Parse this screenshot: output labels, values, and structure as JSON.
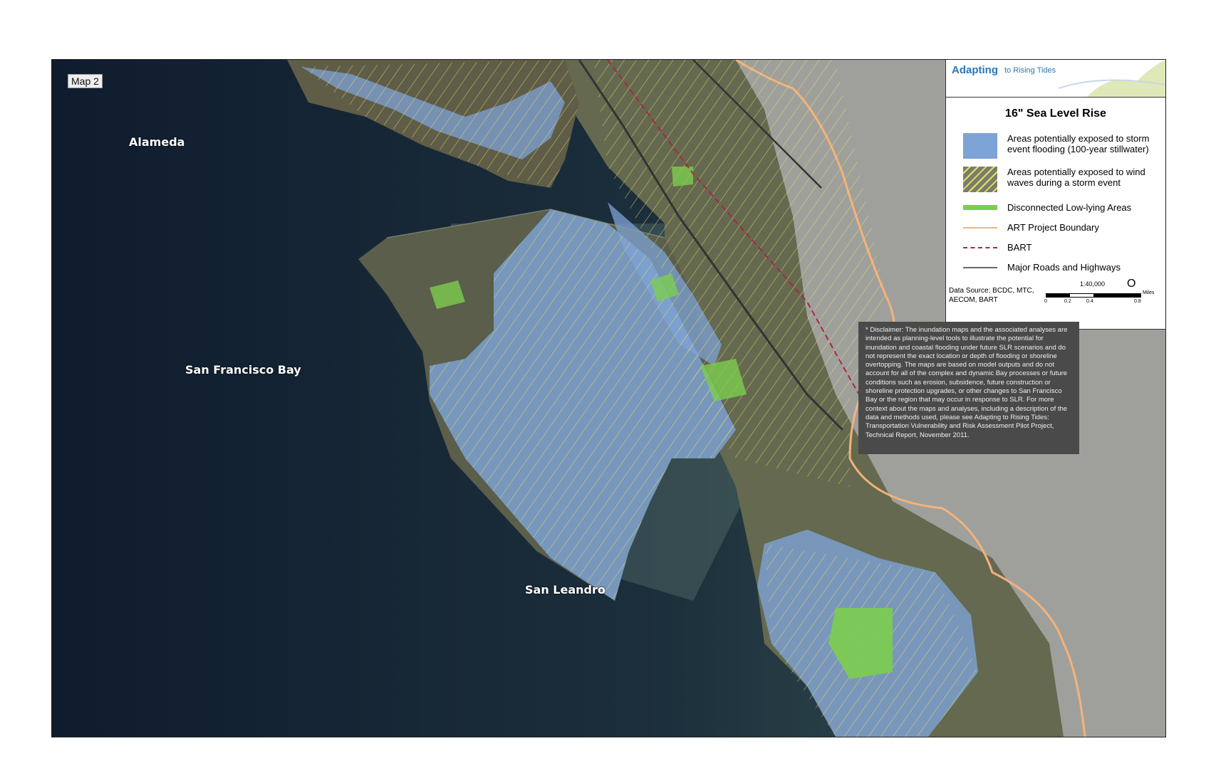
{
  "map": {
    "tag": "Map 2",
    "places": {
      "alameda": "Alameda",
      "sf_bay": "San Francisco Bay",
      "san_leandro": "San Leandro"
    }
  },
  "legend": {
    "logo_main": "Adapting",
    "logo_sub": "to Rising Tides",
    "title": "16\" Sea Level Rise",
    "items": [
      {
        "label": "Areas potentially exposed to storm event flooding (100-year stillwater)",
        "color": "#7ea3d6"
      },
      {
        "label": "Areas potentially exposed to wind waves during a storm event",
        "color": "#e6e06a"
      },
      {
        "label": "Disconnected Low-lying Areas",
        "color": "#7ccd4f"
      },
      {
        "label": "ART Project Boundary",
        "color": "#f4b27a"
      },
      {
        "label": "BART",
        "color": "#a8264a"
      },
      {
        "label": "Major Roads and Highways",
        "color": "#6a6a6a"
      }
    ],
    "data_source_line1": "Data Source: BCDC, MTC,",
    "data_source_line2": "AECOM, BART",
    "scale": "1:40,000",
    "scale_ticks": [
      "0",
      "0.2",
      "0.4",
      "0.8"
    ],
    "scale_unit": "Miles",
    "north_symbol": "O"
  },
  "disclaimer": "* Disclaimer: The inundation maps and the associated analyses are intended as planning-level tools to illustrate the potential for inundation and coastal flooding under future SLR scenarios and do not represent the exact location or depth of flooding or shoreline overtopping. The maps are based on model outputs and do not account for all of the complex and dynamic Bay processes or future conditions such as erosion, subsidence, future construction or shoreline protection upgrades, or other changes to San Francisco Bay or the region that may occur in response to SLR. For more context about the maps and analyses, including a description of the data and methods used, please see Adapting to Rising Tides: Transportation Vulnerability and Risk Assessment Pilot Project, Technical Report, November 2011."
}
